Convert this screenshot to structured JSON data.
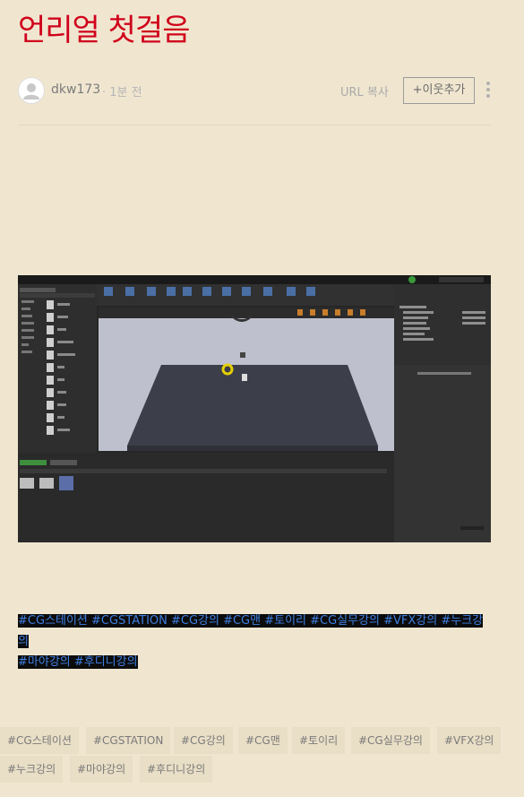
{
  "post": {
    "title": "언리얼 첫걸음",
    "author": "dkw173",
    "time": "· 1분 전",
    "copy_url_label": "URL 복사",
    "follow_label": "+이웃추가"
  },
  "colors": {
    "title": "#d0021b",
    "background": "#f0e6d0",
    "hashtag": "#3f7fe0"
  },
  "image_alt": "Unreal Engine editor screenshot",
  "hashtag_text": [
    "#CG스테이션 #CGSTATION #CG강의 #CG맨 #토이리 #CG실무강의 #VFX강의 #누크강의",
    "#마야강의 #후디니강의"
  ],
  "tags": [
    "#CG스테이션",
    "#CGSTATION",
    "#CG강의",
    "#CG맨",
    "#토이리",
    "#CG실무강의",
    "#VFX강의",
    "#누크강의",
    "#마야강의",
    "#후디니강의"
  ]
}
